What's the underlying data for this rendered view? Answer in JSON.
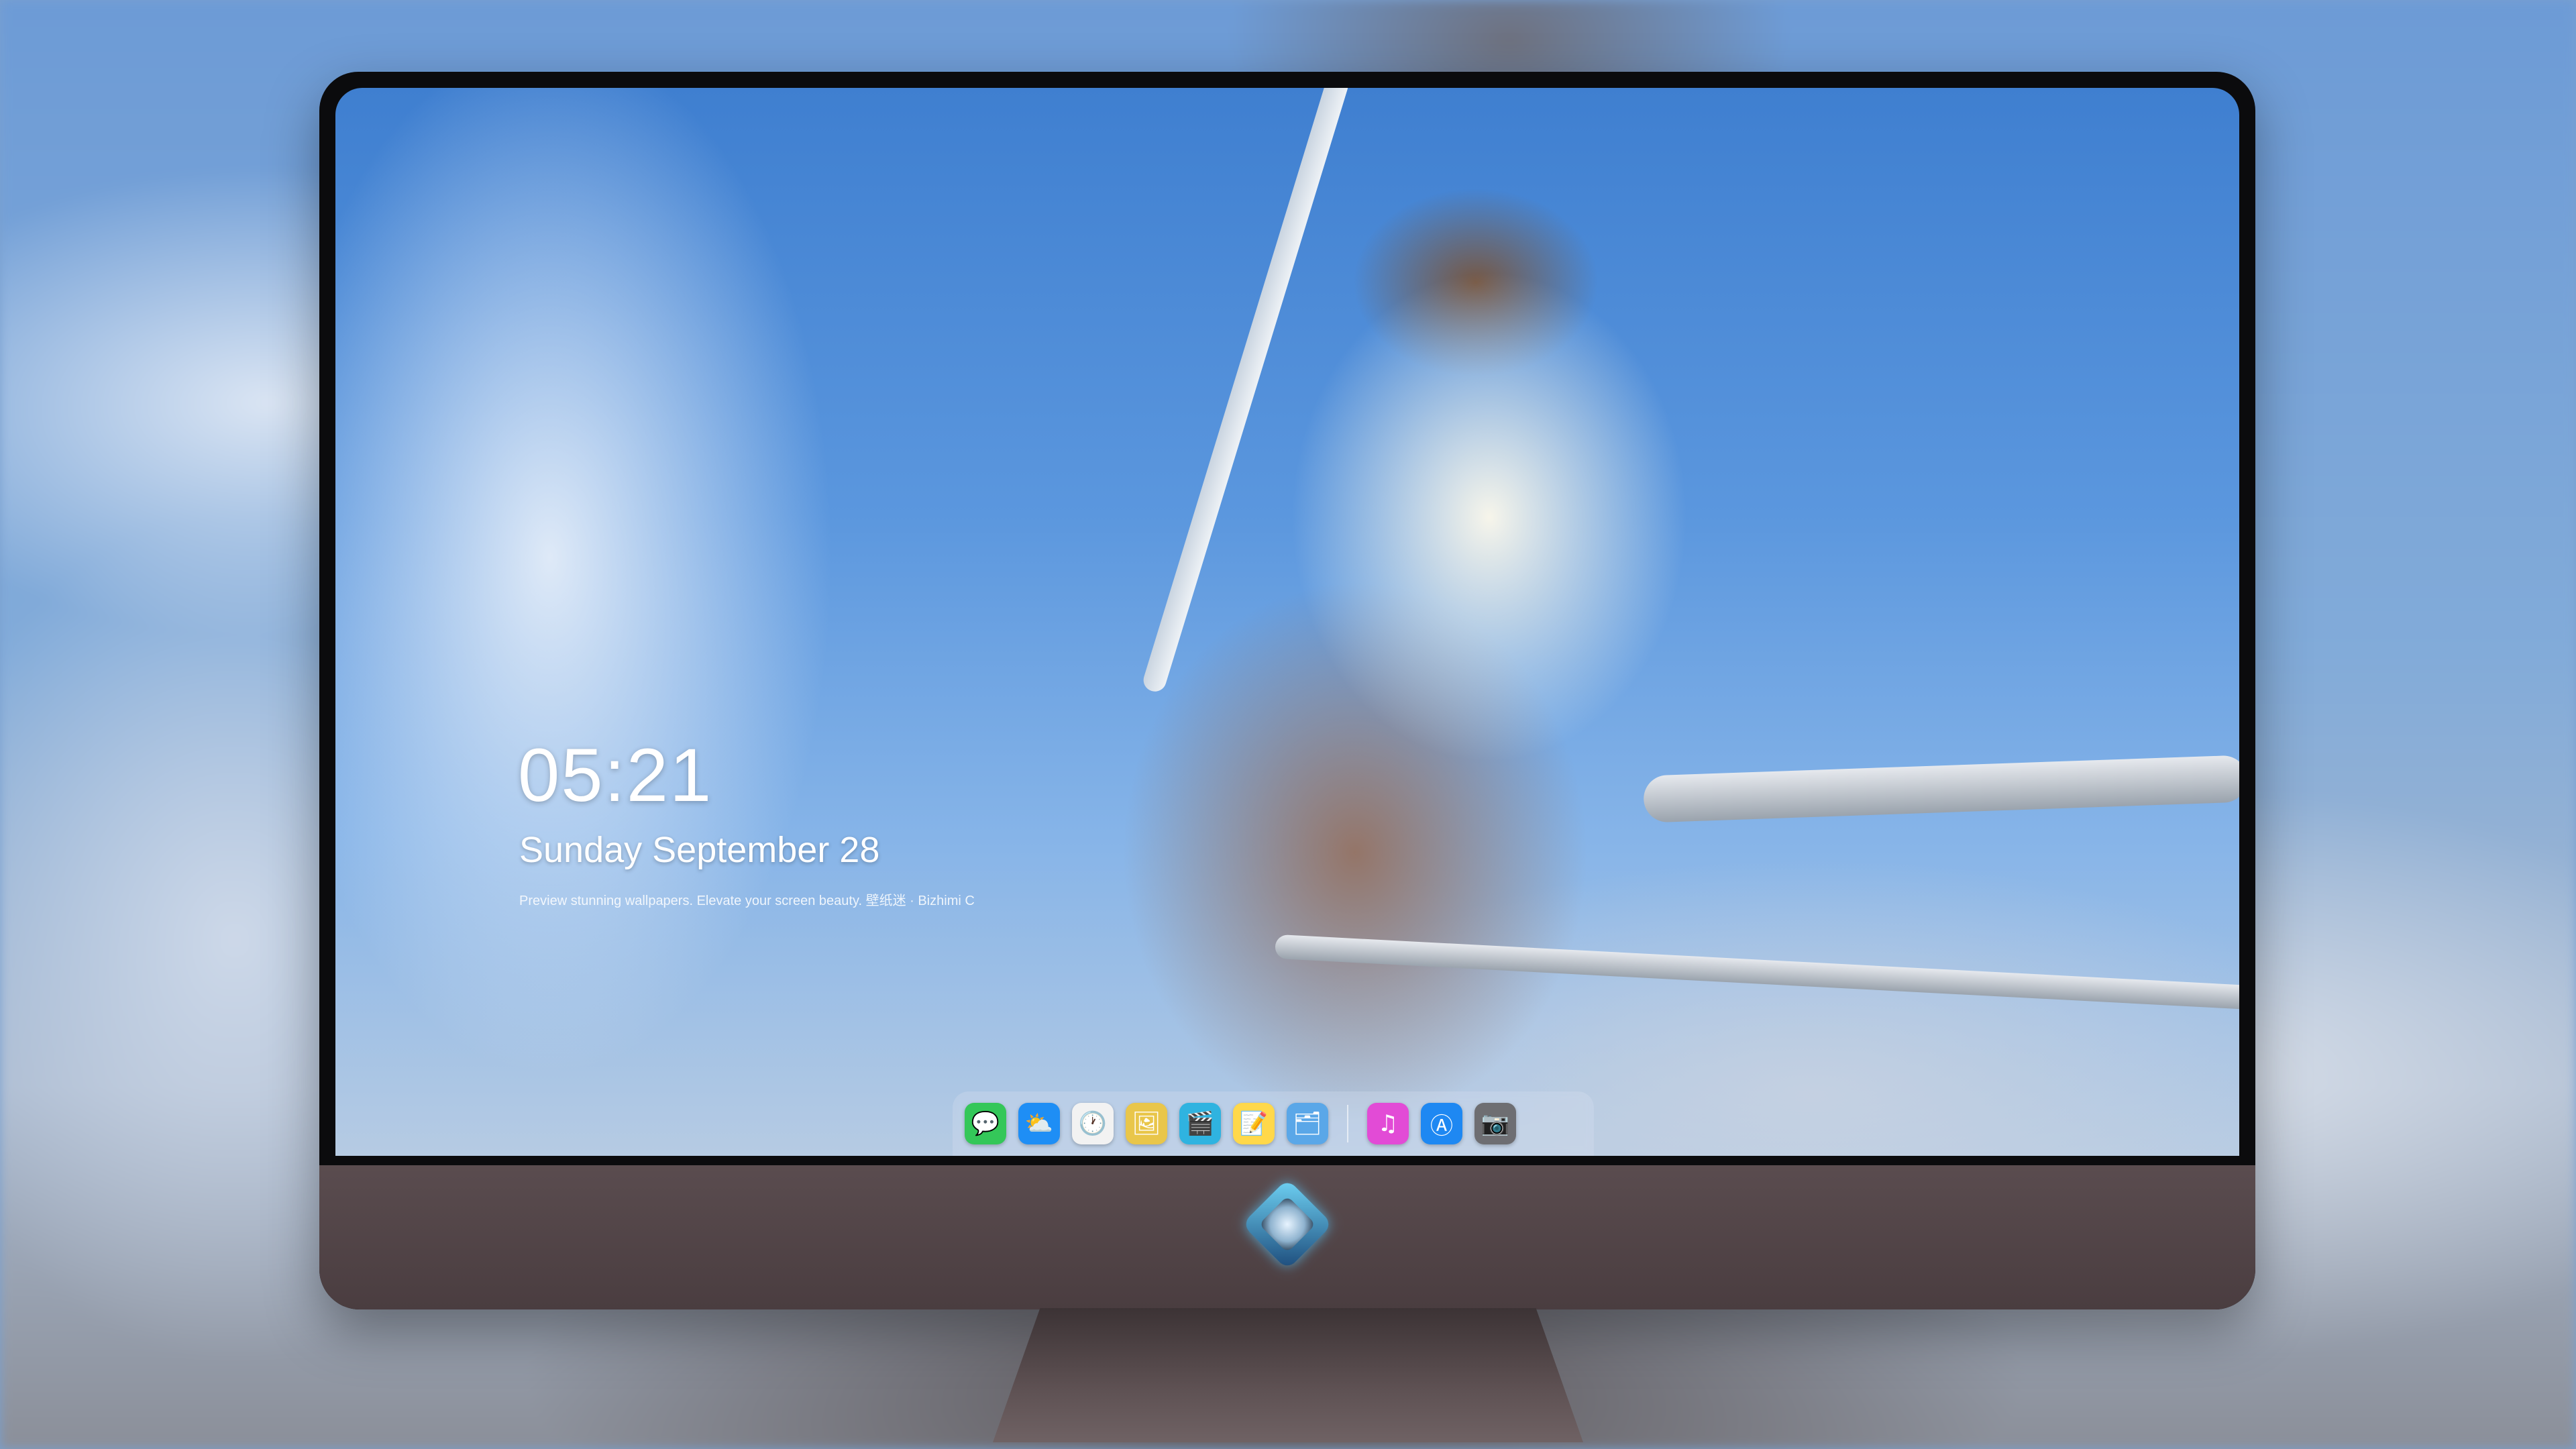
{
  "lock_screen": {
    "time": "05:21",
    "date": "Sunday September 28",
    "caption": "Preview stunning wallpapers. Elevate your screen beauty. 壁纸迷 · Bizhimi C"
  },
  "dock": {
    "apps": [
      {
        "name": "messages-icon",
        "glyph": "💬",
        "color": "#34c759"
      },
      {
        "name": "weather-icon",
        "glyph": "⛅",
        "color": "#1e8ef5"
      },
      {
        "name": "clock-icon",
        "glyph": "🕐",
        "color": "#f2f2f2"
      },
      {
        "name": "preview-icon",
        "glyph": "🖼",
        "color": "#e9c64a"
      },
      {
        "name": "clips-icon",
        "glyph": "🎬",
        "color": "#2fb3e0"
      },
      {
        "name": "notes-icon",
        "glyph": "📝",
        "color": "#ffd84a"
      },
      {
        "name": "photos-app-icon",
        "glyph": "🗂",
        "color": "#5aa7e8"
      },
      {
        "name": "music-icon",
        "glyph": "♫",
        "color": "#e24bd6"
      },
      {
        "name": "app-store-icon",
        "glyph": "Ⓐ",
        "color": "#1e88f2"
      },
      {
        "name": "camera-icon",
        "glyph": "📷",
        "color": "#6e6e72"
      }
    ]
  }
}
